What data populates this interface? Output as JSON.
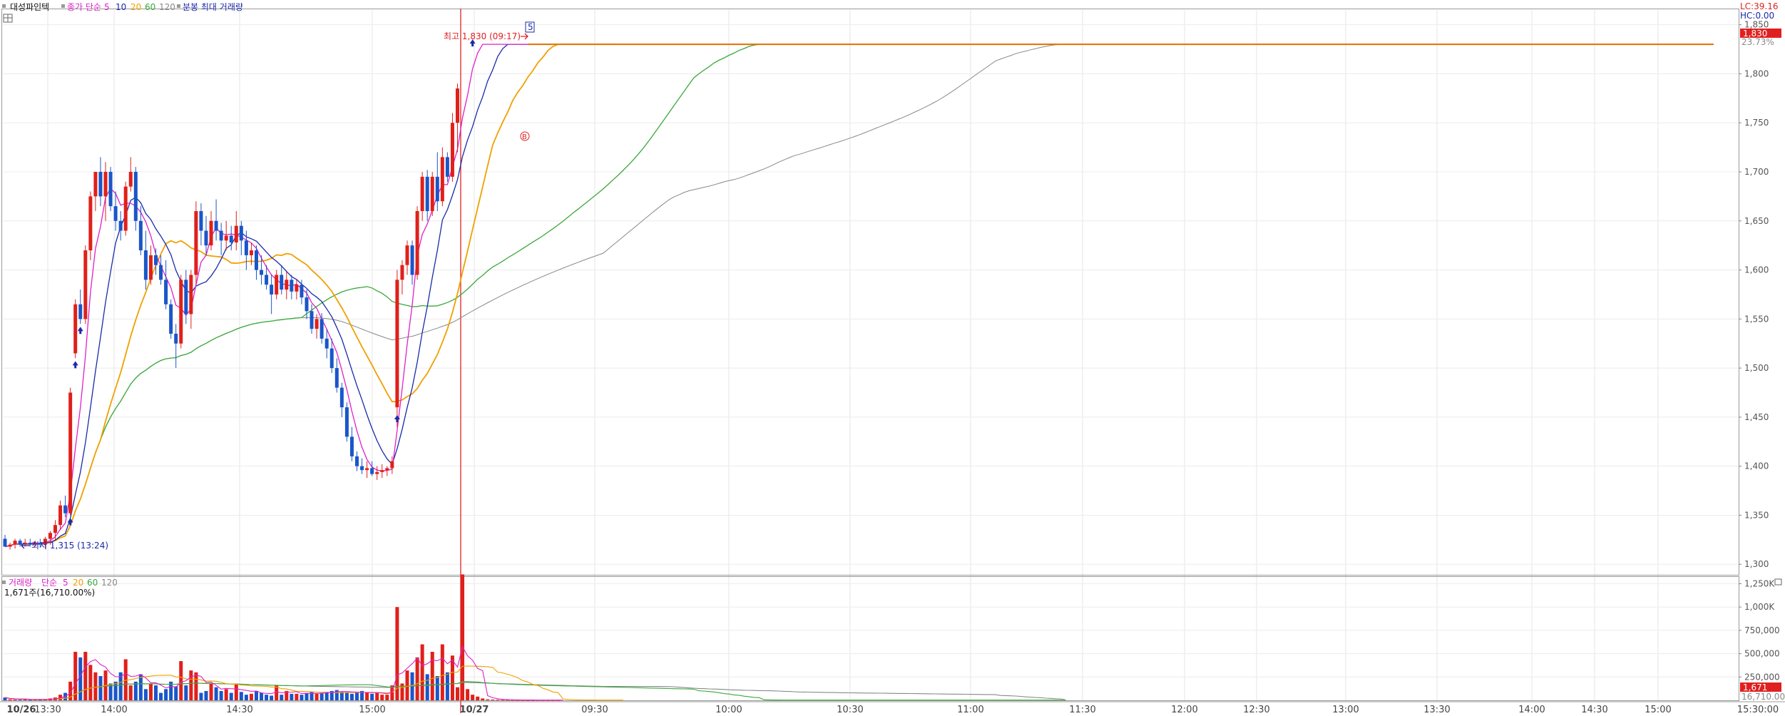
{
  "header": {
    "stock_name": "대성파인텍",
    "price_legend_prefix": "종가 단순",
    "ma_labels": [
      "5",
      "10",
      "20",
      "60",
      "120"
    ],
    "extra_legend": "분봉 최대 거래량",
    "right_top_lc": "LC:39.16",
    "right_top_hc": "HC:0.00",
    "right_pct": "23.73%"
  },
  "volume_header": {
    "title": "거래량",
    "prefix": "단순",
    "ma_labels": [
      "5",
      "20",
      "60",
      "120"
    ],
    "info": "1,671주(16,710.00%)"
  },
  "annotations": {
    "high_label": "최고 1,830 (09:17)",
    "low_label": "최저 1,315 (13:24)",
    "marker_5": "5",
    "marker_b": "B",
    "last_price": "1,830",
    "last_volume": "1,671",
    "last_volume_sub": "16,710.00"
  },
  "colors": {
    "up": "#e0201a",
    "down": "#1a56c9",
    "ma5": "#e020c8",
    "ma10": "#1a2aa8",
    "ma20": "#f0a000",
    "ma60": "#3aa83a",
    "ma120": "#888888"
  },
  "chart_data": {
    "type": "candlestick",
    "price_axis": {
      "ylim": [
        1290,
        1865
      ],
      "ticks": [
        "1,300",
        "1,350",
        "1,400",
        "1,450",
        "1,500",
        "1,550",
        "1,600",
        "1,650",
        "1,700",
        "1,750",
        "1,800",
        "1,850"
      ]
    },
    "volume_axis": {
      "ylim": [
        0,
        1300000
      ],
      "ticks": [
        "250,000",
        "500,000",
        "750,000",
        "1,000K",
        "1,250K"
      ]
    },
    "x_labels": [
      "10/26",
      "13:30",
      "14:00",
      "14:30",
      "15:00",
      "10/27",
      "09:30",
      "10:00",
      "10:30",
      "11:00",
      "11:30",
      "12:00",
      "12:30",
      "13:00",
      "13:30",
      "14:00",
      "14:30",
      "15:00",
      "15:30:00"
    ],
    "candles": [
      {
        "o": 1326,
        "h": 1330,
        "l": 1318,
        "c": 1318
      },
      {
        "o": 1318,
        "h": 1322,
        "l": 1315,
        "c": 1320
      },
      {
        "o": 1320,
        "h": 1326,
        "l": 1316,
        "c": 1324
      },
      {
        "o": 1324,
        "h": 1326,
        "l": 1318,
        "c": 1320
      },
      {
        "o": 1320,
        "h": 1326,
        "l": 1318,
        "c": 1322
      },
      {
        "o": 1322,
        "h": 1326,
        "l": 1318,
        "c": 1320
      },
      {
        "o": 1320,
        "h": 1324,
        "l": 1318,
        "c": 1322
      },
      {
        "o": 1322,
        "h": 1326,
        "l": 1318,
        "c": 1320
      },
      {
        "o": 1320,
        "h": 1328,
        "l": 1316,
        "c": 1326
      },
      {
        "o": 1326,
        "h": 1334,
        "l": 1320,
        "c": 1332
      },
      {
        "o": 1332,
        "h": 1345,
        "l": 1325,
        "c": 1340
      },
      {
        "o": 1340,
        "h": 1365,
        "l": 1335,
        "c": 1360
      },
      {
        "o": 1360,
        "h": 1370,
        "l": 1348,
        "c": 1352
      },
      {
        "o": 1352,
        "h": 1480,
        "l": 1350,
        "c": 1475
      },
      {
        "o": 1515,
        "h": 1570,
        "l": 1510,
        "c": 1565
      },
      {
        "o": 1565,
        "h": 1580,
        "l": 1545,
        "c": 1550
      },
      {
        "o": 1550,
        "h": 1625,
        "l": 1545,
        "c": 1620
      },
      {
        "o": 1620,
        "h": 1680,
        "l": 1610,
        "c": 1675
      },
      {
        "o": 1675,
        "h": 1690,
        "l": 1660,
        "c": 1700
      },
      {
        "o": 1700,
        "h": 1715,
        "l": 1665,
        "c": 1675
      },
      {
        "o": 1675,
        "h": 1710,
        "l": 1650,
        "c": 1700
      },
      {
        "o": 1700,
        "h": 1705,
        "l": 1660,
        "c": 1665
      },
      {
        "o": 1665,
        "h": 1680,
        "l": 1640,
        "c": 1650
      },
      {
        "o": 1650,
        "h": 1660,
        "l": 1630,
        "c": 1640
      },
      {
        "o": 1640,
        "h": 1690,
        "l": 1635,
        "c": 1685
      },
      {
        "o": 1685,
        "h": 1715,
        "l": 1680,
        "c": 1700
      },
      {
        "o": 1700,
        "h": 1705,
        "l": 1640,
        "c": 1650
      },
      {
        "o": 1650,
        "h": 1665,
        "l": 1615,
        "c": 1620
      },
      {
        "o": 1620,
        "h": 1640,
        "l": 1580,
        "c": 1590
      },
      {
        "o": 1590,
        "h": 1625,
        "l": 1585,
        "c": 1615
      },
      {
        "o": 1615,
        "h": 1622,
        "l": 1595,
        "c": 1605
      },
      {
        "o": 1605,
        "h": 1615,
        "l": 1585,
        "c": 1590
      },
      {
        "o": 1590,
        "h": 1610,
        "l": 1560,
        "c": 1565
      },
      {
        "o": 1565,
        "h": 1570,
        "l": 1530,
        "c": 1535
      },
      {
        "o": 1535,
        "h": 1545,
        "l": 1500,
        "c": 1525
      },
      {
        "o": 1525,
        "h": 1595,
        "l": 1520,
        "c": 1590
      },
      {
        "o": 1590,
        "h": 1600,
        "l": 1545,
        "c": 1555
      },
      {
        "o": 1555,
        "h": 1600,
        "l": 1540,
        "c": 1595
      },
      {
        "o": 1595,
        "h": 1670,
        "l": 1585,
        "c": 1660
      },
      {
        "o": 1660,
        "h": 1668,
        "l": 1625,
        "c": 1640
      },
      {
        "o": 1640,
        "h": 1655,
        "l": 1615,
        "c": 1625
      },
      {
        "o": 1625,
        "h": 1660,
        "l": 1620,
        "c": 1650
      },
      {
        "o": 1650,
        "h": 1672,
        "l": 1630,
        "c": 1640
      },
      {
        "o": 1640,
        "h": 1648,
        "l": 1615,
        "c": 1630
      },
      {
        "o": 1630,
        "h": 1650,
        "l": 1620,
        "c": 1635
      },
      {
        "o": 1635,
        "h": 1645,
        "l": 1620,
        "c": 1628
      },
      {
        "o": 1628,
        "h": 1660,
        "l": 1620,
        "c": 1645
      },
      {
        "o": 1645,
        "h": 1650,
        "l": 1615,
        "c": 1630
      },
      {
        "o": 1630,
        "h": 1640,
        "l": 1600,
        "c": 1615
      },
      {
        "o": 1615,
        "h": 1628,
        "l": 1605,
        "c": 1620
      },
      {
        "o": 1620,
        "h": 1625,
        "l": 1590,
        "c": 1600
      },
      {
        "o": 1600,
        "h": 1615,
        "l": 1585,
        "c": 1595
      },
      {
        "o": 1595,
        "h": 1605,
        "l": 1580,
        "c": 1585
      },
      {
        "o": 1585,
        "h": 1595,
        "l": 1555,
        "c": 1575
      },
      {
        "o": 1575,
        "h": 1600,
        "l": 1570,
        "c": 1595
      },
      {
        "o": 1595,
        "h": 1605,
        "l": 1575,
        "c": 1580
      },
      {
        "o": 1580,
        "h": 1598,
        "l": 1570,
        "c": 1590
      },
      {
        "o": 1590,
        "h": 1595,
        "l": 1570,
        "c": 1578
      },
      {
        "o": 1578,
        "h": 1590,
        "l": 1570,
        "c": 1585
      },
      {
        "o": 1585,
        "h": 1590,
        "l": 1565,
        "c": 1572
      },
      {
        "o": 1572,
        "h": 1580,
        "l": 1550,
        "c": 1558
      },
      {
        "o": 1558,
        "h": 1565,
        "l": 1535,
        "c": 1540
      },
      {
        "o": 1540,
        "h": 1555,
        "l": 1530,
        "c": 1550
      },
      {
        "o": 1550,
        "h": 1556,
        "l": 1525,
        "c": 1530
      },
      {
        "o": 1530,
        "h": 1540,
        "l": 1510,
        "c": 1520
      },
      {
        "o": 1520,
        "h": 1530,
        "l": 1495,
        "c": 1500
      },
      {
        "o": 1500,
        "h": 1510,
        "l": 1475,
        "c": 1480
      },
      {
        "o": 1480,
        "h": 1485,
        "l": 1450,
        "c": 1460
      },
      {
        "o": 1460,
        "h": 1465,
        "l": 1425,
        "c": 1430
      },
      {
        "o": 1430,
        "h": 1440,
        "l": 1405,
        "c": 1410
      },
      {
        "o": 1410,
        "h": 1415,
        "l": 1395,
        "c": 1400
      },
      {
        "o": 1400,
        "h": 1408,
        "l": 1392,
        "c": 1396
      },
      {
        "o": 1396,
        "h": 1405,
        "l": 1388,
        "c": 1398
      },
      {
        "o": 1398,
        "h": 1405,
        "l": 1390,
        "c": 1392
      },
      {
        "o": 1392,
        "h": 1400,
        "l": 1386,
        "c": 1394
      },
      {
        "o": 1394,
        "h": 1402,
        "l": 1388,
        "c": 1396
      },
      {
        "o": 1396,
        "h": 1400,
        "l": 1390,
        "c": 1398
      },
      {
        "o": 1398,
        "h": 1410,
        "l": 1392,
        "c": 1405
      },
      {
        "o": 1460,
        "h": 1600,
        "l": 1440,
        "c": 1590
      },
      {
        "o": 1590,
        "h": 1610,
        "l": 1575,
        "c": 1605
      },
      {
        "o": 1605,
        "h": 1630,
        "l": 1595,
        "c": 1625
      },
      {
        "o": 1625,
        "h": 1630,
        "l": 1585,
        "c": 1595
      },
      {
        "o": 1595,
        "h": 1665,
        "l": 1590,
        "c": 1660
      },
      {
        "o": 1660,
        "h": 1700,
        "l": 1650,
        "c": 1695
      },
      {
        "o": 1695,
        "h": 1702,
        "l": 1650,
        "c": 1660
      },
      {
        "o": 1660,
        "h": 1700,
        "l": 1655,
        "c": 1695
      },
      {
        "o": 1695,
        "h": 1720,
        "l": 1660,
        "c": 1670
      },
      {
        "o": 1670,
        "h": 1725,
        "l": 1665,
        "c": 1715
      },
      {
        "o": 1715,
        "h": 1720,
        "l": 1690,
        "c": 1695
      },
      {
        "o": 1695,
        "h": 1760,
        "l": 1690,
        "c": 1750
      },
      {
        "o": 1750,
        "h": 1790,
        "l": 1720,
        "c": 1785
      }
    ],
    "volume": [
      30000,
      10000,
      8000,
      6000,
      12000,
      5000,
      8000,
      6000,
      12000,
      20000,
      30000,
      60000,
      80000,
      200000,
      520000,
      460000,
      520000,
      380000,
      300000,
      260000,
      320000,
      180000,
      200000,
      300000,
      440000,
      160000,
      200000,
      280000,
      120000,
      180000,
      160000,
      80000,
      120000,
      200000,
      150000,
      420000,
      160000,
      320000,
      300000,
      80000,
      100000,
      180000,
      140000,
      100000,
      120000,
      80000,
      180000,
      90000,
      60000,
      70000,
      100000,
      80000,
      60000,
      50000,
      160000,
      60000,
      100000,
      70000,
      70000,
      60000,
      80000,
      90000,
      70000,
      80000,
      90000,
      100000,
      110000,
      90000,
      80000,
      70000,
      90000,
      100000,
      80000,
      70000,
      80000,
      60000,
      60000,
      160000,
      1000000,
      180000,
      320000,
      300000,
      460000,
      600000,
      280000,
      520000,
      260000,
      600000,
      300000,
      480000,
      140000,
      1350000,
      120000,
      60000,
      40000,
      20000,
      10000,
      8000,
      6000,
      5000,
      5000,
      4000,
      3000,
      3000,
      2000,
      2000,
      2000,
      2000,
      2000,
      2000,
      2000
    ]
  }
}
